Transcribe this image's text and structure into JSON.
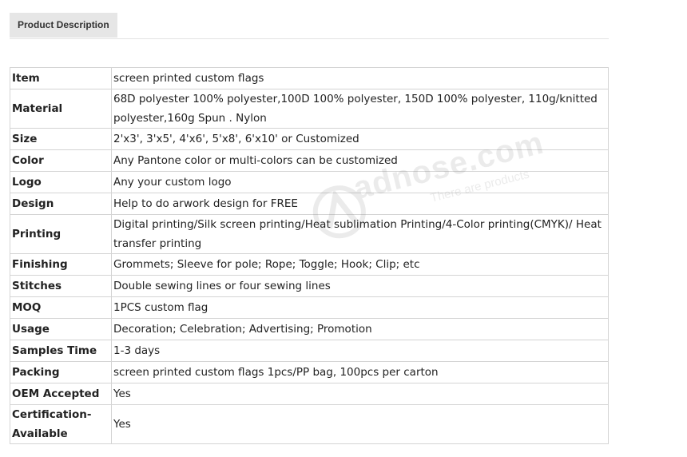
{
  "tab": {
    "label": "Product Description"
  },
  "specs": [
    {
      "label": "Item",
      "value": "screen printed custom flags"
    },
    {
      "label": "Material",
      "value": "68D polyester 100% polyester,100D 100% polyester, 150D 100% polyester, 110g/knitted polyester,160g Spun . Nylon"
    },
    {
      "label": "Size",
      "value": "2'x3', 3'x5', 4'x6', 5'x8', 6'x10' or Customized"
    },
    {
      "label": "Color",
      "value": "Any Pantone color or multi-colors can be customized"
    },
    {
      "label": "Logo",
      "value": "Any your custom logo"
    },
    {
      "label": "Design",
      "value": "Help to do arwork design for FREE"
    },
    {
      "label": "Printing",
      "value": "Digital printing/Silk screen printing/Heat sublimation Printing/4-Color printing(CMYK)/ Heat transfer printing"
    },
    {
      "label": "Finishing",
      "value": "Grommets; Sleeve for pole; Rope; Toggle; Hook; Clip; etc"
    },
    {
      "label": "Stitches",
      "value": "Double sewing lines or four sewing lines"
    },
    {
      "label": "MOQ",
      "value": "1PCS custom flag"
    },
    {
      "label": "Usage",
      "value": "Decoration; Celebration; Advertising; Promotion"
    },
    {
      "label": "Samples Time",
      "value": "1-3 days"
    },
    {
      "label": "Packing",
      "value": "screen printed custom flags  1pcs/PP bag, 100pcs per carton"
    },
    {
      "label": "OEM Accepted",
      "value": "Yes"
    },
    {
      "label": "Certification-Available",
      "value": "Yes"
    }
  ],
  "watermark": {
    "text": "adnose.com",
    "tagline": "There are products"
  },
  "colors": {
    "tab_background": "#e6e6e6",
    "border": "#d4d4d4",
    "text": "#222222"
  }
}
